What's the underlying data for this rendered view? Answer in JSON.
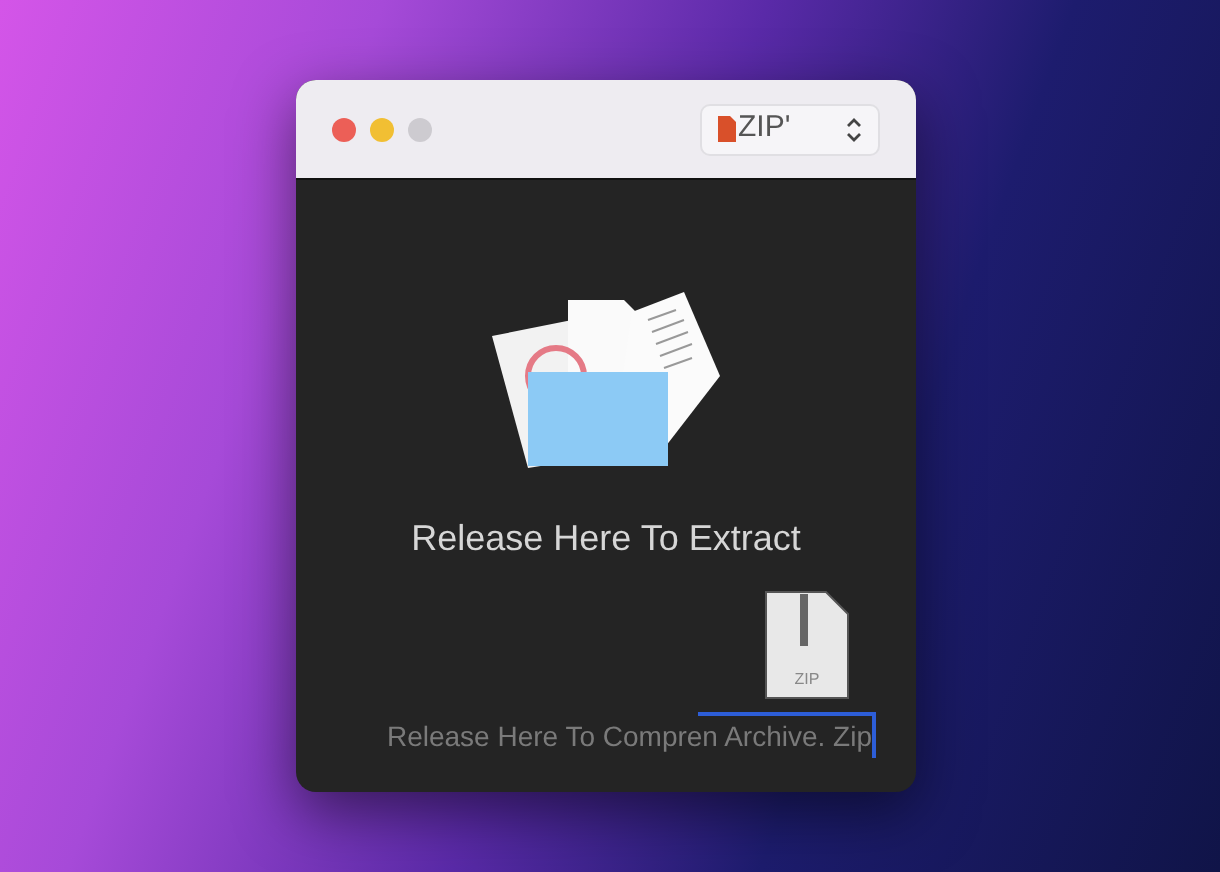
{
  "window": {
    "format_selector": {
      "label": "ZIP'"
    }
  },
  "drop_zone": {
    "extract_label": "Release Here To Extract",
    "archive_file_label": "ZIP",
    "compress_label": "Release Here To Compren Archive. Zip"
  }
}
